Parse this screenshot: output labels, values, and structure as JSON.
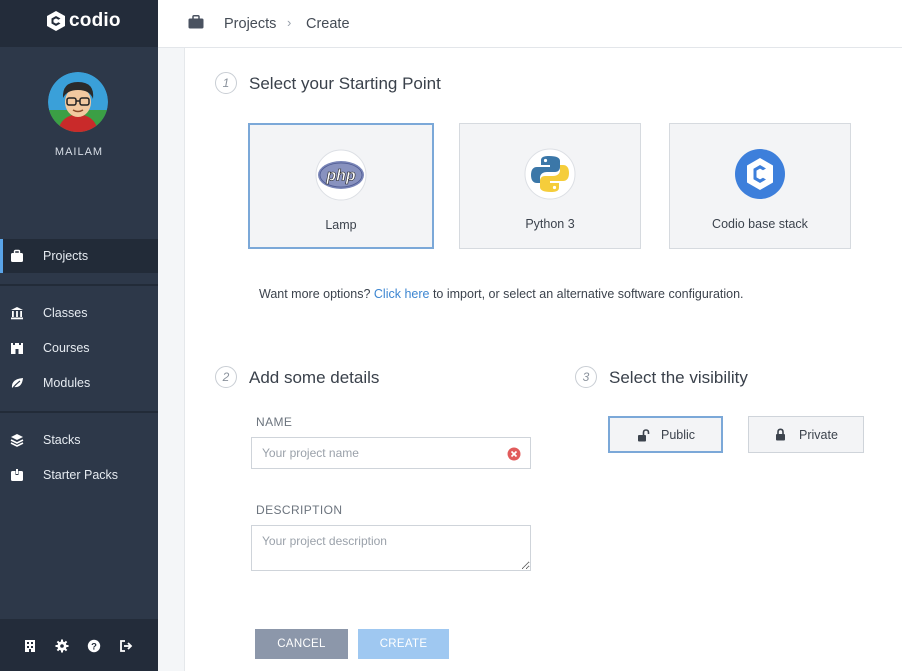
{
  "app": {
    "logo_text": "codio"
  },
  "user": {
    "name": "MAILAM"
  },
  "sidebar": {
    "items": [
      {
        "label": "Projects",
        "icon": "briefcase-icon",
        "active": true
      },
      {
        "label": "Classes",
        "icon": "institution-icon"
      },
      {
        "label": "Courses",
        "icon": "castle-icon"
      },
      {
        "label": "Modules",
        "icon": "leaf-icon"
      },
      {
        "label": "Stacks",
        "icon": "layers-icon"
      },
      {
        "label": "Starter Packs",
        "icon": "package-icon"
      }
    ],
    "bottom_icons": [
      "building-icon",
      "gear-icon",
      "help-icon",
      "logout-icon"
    ]
  },
  "header": {
    "breadcrumb": [
      "Projects",
      "Create"
    ],
    "separator": "›"
  },
  "step1": {
    "number": "1",
    "title": "Select your Starting Point",
    "cards": [
      {
        "label": "Lamp",
        "icon": "php-icon",
        "selected": true
      },
      {
        "label": "Python 3",
        "icon": "python-icon"
      },
      {
        "label": "Codio base stack",
        "icon": "codio-icon"
      }
    ],
    "more_prefix": "Want more options?",
    "more_link": "Click here",
    "more_suffix": "to import, or select an alternative software configuration."
  },
  "step2": {
    "number": "2",
    "title": "Add some details",
    "name_label": "NAME",
    "name_value": "",
    "name_placeholder": "Your project name",
    "description_label": "DESCRIPTION",
    "description_value": "",
    "description_placeholder": "Your project description"
  },
  "step3": {
    "number": "3",
    "title": "Select the visibility",
    "options": [
      {
        "label": "Public",
        "icon": "unlock-icon",
        "selected": true
      },
      {
        "label": "Private",
        "icon": "lock-icon"
      }
    ]
  },
  "actions": {
    "cancel": "CANCEL",
    "create": "CREATE"
  },
  "colors": {
    "sidebar_bg": "#2d3849",
    "accent": "#5aa4e8",
    "selected_border": "#7ba8d8",
    "cancel_bg": "#8c97aa",
    "create_bg": "#9fc8f1",
    "link": "#3d86d1"
  }
}
